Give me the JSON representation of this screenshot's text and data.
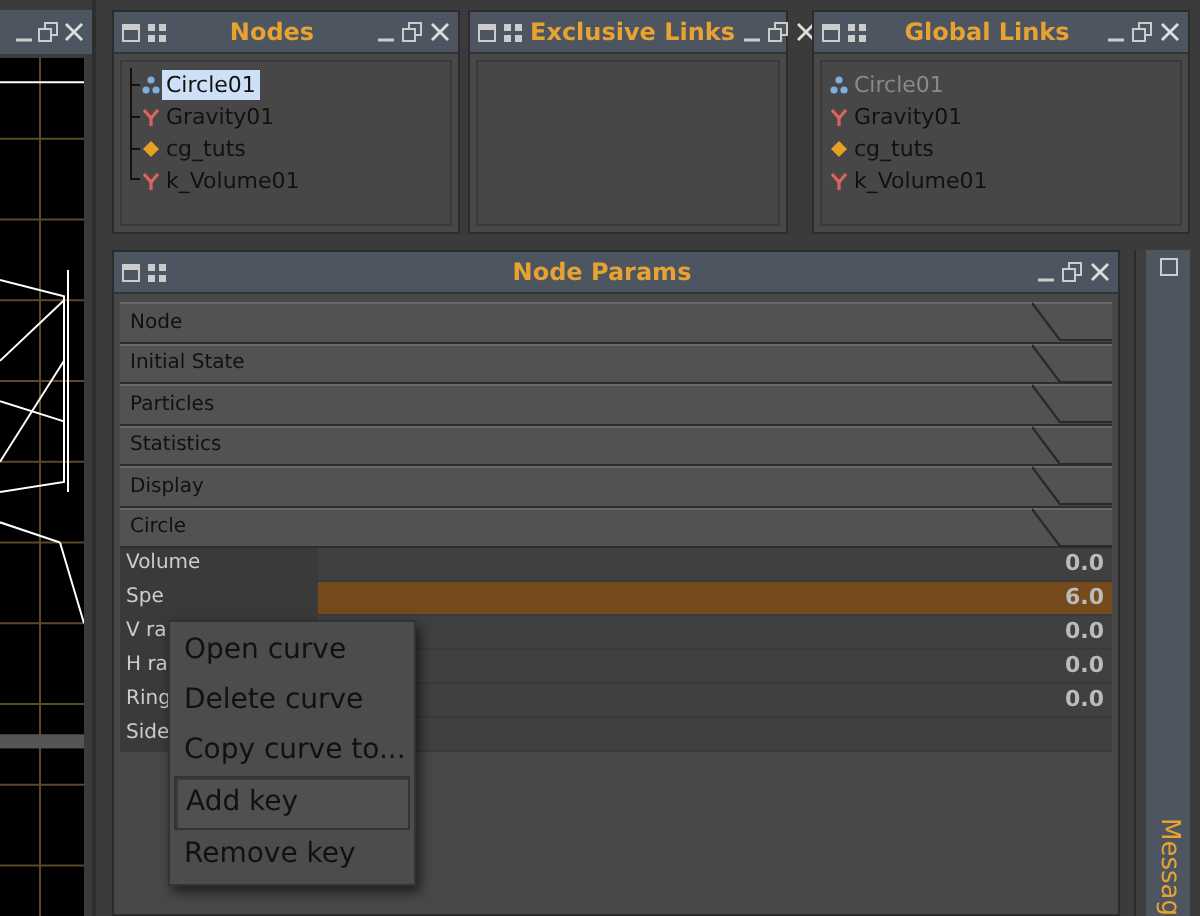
{
  "panels": [
    {
      "title": "Nodes",
      "kind": "tree",
      "items": [
        {
          "label": "Circle01",
          "kind": "circle",
          "selected": true
        },
        {
          "label": "Gravity01",
          "kind": "force",
          "selected": false
        },
        {
          "label": "cg_tuts",
          "kind": "event",
          "selected": false
        },
        {
          "label": "k_Volume01",
          "kind": "force",
          "selected": false
        }
      ]
    },
    {
      "title": "Exclusive Links",
      "kind": "list"
    },
    {
      "title": "Global Links",
      "kind": "list",
      "items": [
        {
          "label": "Circle01",
          "kind": "circle",
          "disabled": true
        },
        {
          "label": "Gravity01",
          "kind": "force",
          "disabled": false
        },
        {
          "label": "cg_tuts",
          "kind": "event",
          "disabled": false
        },
        {
          "label": "k_Volume01",
          "kind": "force",
          "disabled": false
        }
      ]
    }
  ],
  "node_params": {
    "title": "Node Params",
    "sections": [
      "Node",
      "Initial State",
      "Particles",
      "Statistics",
      "Display",
      "Circle"
    ],
    "params": [
      {
        "label": "Volume",
        "value": "0.0",
        "selected": false
      },
      {
        "label": "Spe",
        "value": "6.0",
        "selected": true
      },
      {
        "label": "V ra",
        "value": "0.0",
        "selected": false
      },
      {
        "label": "H ra",
        "value": "0.0",
        "selected": false
      },
      {
        "label": "Ring",
        "value": "0.0",
        "selected": false
      },
      {
        "label": "Side",
        "selected": false
      }
    ]
  },
  "context_menu": {
    "items": [
      {
        "label": "Open curve",
        "selected": false
      },
      {
        "label": "Delete curve",
        "selected": false
      },
      {
        "label": "Copy curve to...",
        "selected": false
      },
      {
        "label": "Add key",
        "selected": true
      },
      {
        "label": "Remove key",
        "selected": false
      }
    ]
  },
  "messages": {
    "title": "Messag"
  }
}
